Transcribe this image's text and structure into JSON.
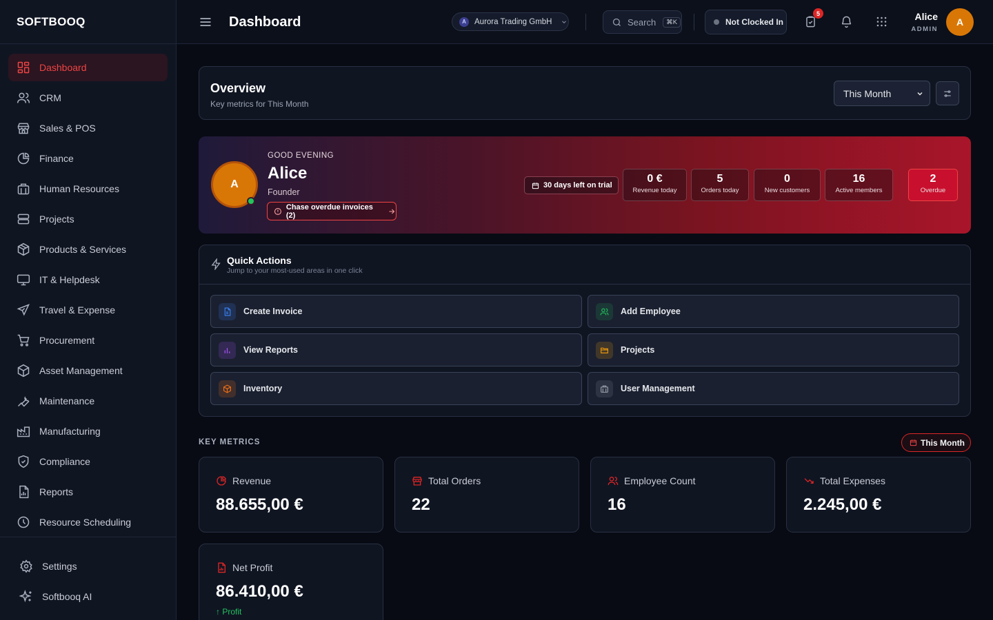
{
  "app": {
    "logo": "SOFTBOOQ"
  },
  "sidebar": {
    "items": [
      {
        "label": "Dashboard",
        "icon": "dashboard-icon",
        "active": true
      },
      {
        "label": "CRM",
        "icon": "users-icon"
      },
      {
        "label": "Sales & POS",
        "icon": "store-icon"
      },
      {
        "label": "Finance",
        "icon": "pie-chart-icon"
      },
      {
        "label": "Human Resources",
        "icon": "building-icon"
      },
      {
        "label": "Projects",
        "icon": "layers-icon"
      },
      {
        "label": "Products & Services",
        "icon": "package-icon"
      },
      {
        "label": "IT & Helpdesk",
        "icon": "monitor-icon"
      },
      {
        "label": "Travel & Expense",
        "icon": "plane-icon"
      },
      {
        "label": "Procurement",
        "icon": "cart-icon"
      },
      {
        "label": "Asset Management",
        "icon": "box-icon"
      },
      {
        "label": "Maintenance",
        "icon": "wrench-icon"
      },
      {
        "label": "Manufacturing",
        "icon": "factory-icon"
      },
      {
        "label": "Compliance",
        "icon": "shield-icon"
      },
      {
        "label": "Reports",
        "icon": "report-icon"
      },
      {
        "label": "Resource Scheduling",
        "icon": "clock-icon"
      }
    ],
    "bottom": [
      {
        "label": "Settings",
        "icon": "gear-icon"
      },
      {
        "label": "Softbooq AI",
        "icon": "sparkles-icon"
      }
    ]
  },
  "header": {
    "title": "Dashboard",
    "company": {
      "initial": "A",
      "name": "Aurora Trading GmbH"
    },
    "search": {
      "label": "Search",
      "shortcut": "⌘K"
    },
    "clock_status": "Not Clocked In",
    "tasks_badge": "5",
    "user": {
      "name": "Alice",
      "role": "ADMIN",
      "initial": "A"
    }
  },
  "overview": {
    "title": "Overview",
    "subtitle": "Key metrics for This Month",
    "period": "This Month"
  },
  "hero": {
    "greeting": "GOOD EVENING",
    "name": "Alice",
    "role": "Founder",
    "avatar_initial": "A",
    "action": "Chase overdue invoices (2)",
    "trial": "30 days left on trial",
    "stats": [
      {
        "value": "0 €",
        "label": "Revenue today"
      },
      {
        "value": "5",
        "label": "Orders today"
      },
      {
        "value": "0",
        "label": "New customers"
      },
      {
        "value": "16",
        "label": "Active members"
      },
      {
        "value": "2",
        "label": "Overdue"
      }
    ]
  },
  "quick_actions": {
    "title": "Quick Actions",
    "subtitle": "Jump to your most-used areas in one click",
    "items": [
      {
        "label": "Create Invoice",
        "icon": "file-icon",
        "color": "#3b82f6"
      },
      {
        "label": "Add Employee",
        "icon": "users-icon",
        "color": "#22c55e"
      },
      {
        "label": "View Reports",
        "icon": "bar-chart-icon",
        "color": "#a855f7"
      },
      {
        "label": "Projects",
        "icon": "folder-icon",
        "color": "#f59e0b"
      },
      {
        "label": "Inventory",
        "icon": "package-icon",
        "color": "#f97316"
      },
      {
        "label": "User Management",
        "icon": "building-icon",
        "color": "#9ca3af"
      }
    ]
  },
  "key_metrics": {
    "label": "KEY METRICS",
    "period": "This Month",
    "items": [
      {
        "label": "Revenue",
        "value": "88.655,00 €",
        "icon": "pie-chart-icon"
      },
      {
        "label": "Total Orders",
        "value": "22",
        "icon": "store-icon"
      },
      {
        "label": "Employee Count",
        "value": "16",
        "icon": "users-icon"
      },
      {
        "label": "Total Expenses",
        "value": "2.245,00 €",
        "icon": "trending-down-icon"
      },
      {
        "label": "Net Profit",
        "value": "86.410,00 €",
        "icon": "report-icon",
        "trend": "↑ Profit"
      }
    ]
  },
  "colors": {
    "accent": "#dc2626",
    "background": "#080b14",
    "surface": "#101522",
    "success": "#22c55e"
  }
}
